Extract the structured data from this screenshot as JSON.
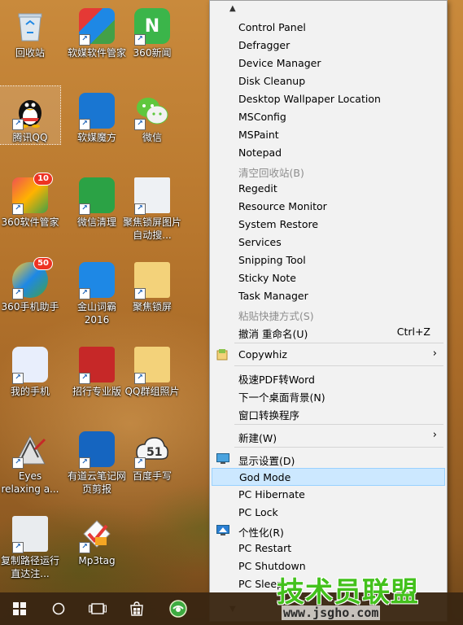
{
  "desktop": {
    "icons": [
      {
        "label": "回收站",
        "icon": "recycle-bin-icon"
      },
      {
        "label": "软媒软件管家",
        "icon": "ruanmei-software-manager-icon"
      },
      {
        "label": "360新闻",
        "icon": "360-news-icon",
        "glyph": "N"
      },
      {
        "label": "腾讯QQ",
        "icon": "qq-penguin-icon"
      },
      {
        "label": "软媒魔方",
        "icon": "ruanmei-cube-icon"
      },
      {
        "label": "微信",
        "icon": "wechat-icon"
      },
      {
        "label": "360软件管家",
        "icon": "360-software-manager-icon",
        "badge": "10"
      },
      {
        "label": "微信清理",
        "icon": "wechat-cleaner-icon"
      },
      {
        "label": "聚焦锁屏图片自动搜...",
        "icon": "spotlight-image-icon"
      },
      {
        "label": "360手机助手",
        "icon": "360-phone-assistant-icon",
        "badge": "50"
      },
      {
        "label": "金山词霸2016",
        "icon": "kingsoft-powerword-icon"
      },
      {
        "label": "聚焦锁屏",
        "icon": "folder-icon"
      },
      {
        "label": "我的手机",
        "icon": "my-phone-icon"
      },
      {
        "label": "招行专业版",
        "icon": "cmb-bank-icon"
      },
      {
        "label": "QQ群组照片",
        "icon": "folder-photos-icon"
      },
      {
        "label": "Eyes relaxing a...",
        "icon": "eyes-relaxing-icon"
      },
      {
        "label": "有道云笔记网页剪报",
        "icon": "youdao-clipper-icon"
      },
      {
        "label": "百度手写",
        "icon": "baidu-handwriting-icon"
      },
      {
        "label": "复制路径运行直达注...",
        "icon": "copy-path-script-icon"
      },
      {
        "label": "Mp3tag",
        "icon": "mp3tag-icon"
      }
    ]
  },
  "context_menu": {
    "scroll_up": "▲",
    "scroll_down": "▼",
    "items": [
      {
        "label": "Control Panel"
      },
      {
        "label": "Defragger"
      },
      {
        "label": "Device Manager"
      },
      {
        "label": "Disk Cleanup"
      },
      {
        "label": "Desktop Wallpaper Location"
      },
      {
        "label": "MSConfig"
      },
      {
        "label": "MSPaint"
      },
      {
        "label": "Notepad"
      },
      {
        "label": "清空回收站(B)"
      },
      {
        "label": "Regedit"
      },
      {
        "label": "Resource Monitor"
      },
      {
        "label": "System Restore"
      },
      {
        "label": "Services"
      },
      {
        "label": "Snipping Tool"
      },
      {
        "label": "Sticky Note"
      },
      {
        "label": "Task Manager"
      },
      {
        "label": "粘贴快捷方式(S)"
      },
      {
        "label": "撤消 重命名(U)",
        "shortcut": "Ctrl+Z"
      },
      {
        "label": "Copywhiz",
        "arrow": "›"
      },
      {
        "label": "极速PDF转Word"
      },
      {
        "label": "下一个桌面背景(N)"
      },
      {
        "label": "窗口转换程序"
      },
      {
        "label": "新建(W)",
        "arrow": "›"
      },
      {
        "label": "显示设置(D)"
      },
      {
        "label": "God Mode"
      },
      {
        "label": "PC Hibernate"
      },
      {
        "label": "PC Lock"
      },
      {
        "label": "个性化(R)"
      },
      {
        "label": "PC Restart"
      },
      {
        "label": "PC Shutdown"
      },
      {
        "label": "PC Sleep"
      }
    ],
    "disabled": [
      "清空回收站(B)",
      "粘贴快捷方式(S)"
    ],
    "highlighted": "God Mode"
  },
  "taskbar": {
    "buttons": [
      "start-windows-icon",
      "cortana-circle-icon",
      "task-view-icon",
      "store-icon",
      "360-browser-icon"
    ]
  },
  "watermark": {
    "title": "技术员联盟",
    "url": "www.jsgho.com"
  },
  "colors": {
    "menu_bg": "#f2f2f2",
    "highlight": "#cce8ff",
    "watermark_green": "#43c11c"
  }
}
